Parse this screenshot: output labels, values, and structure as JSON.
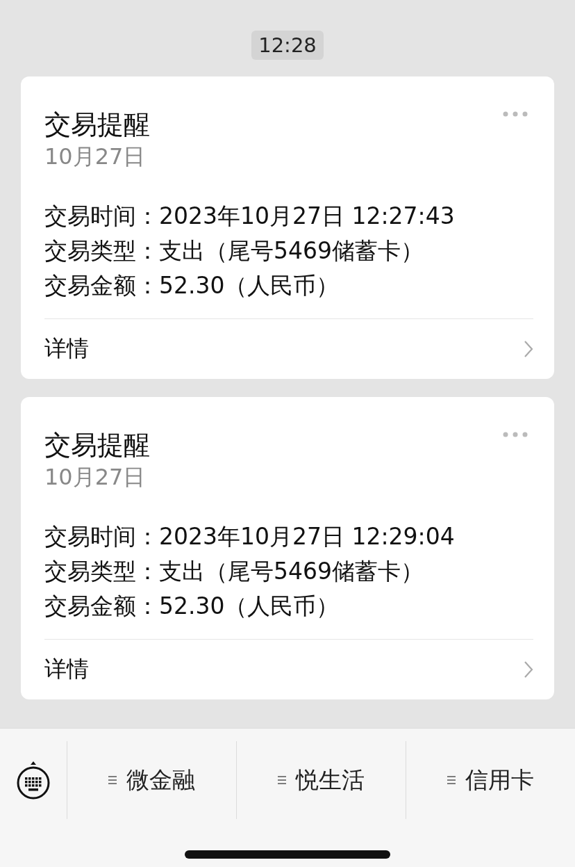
{
  "time": "12:28",
  "messages": [
    {
      "title": "交易提醒",
      "date": "10月27日",
      "fields": [
        {
          "label": "交易时间：",
          "value": "2023年10月27日 12:27:43"
        },
        {
          "label": "交易类型：",
          "value": "支出（尾号5469储蓄卡）"
        },
        {
          "label": "交易金额：",
          "value": "52.30（人民币）"
        }
      ],
      "link": "详情"
    },
    {
      "title": "交易提醒",
      "date": "10月27日",
      "fields": [
        {
          "label": "交易时间：",
          "value": "2023年10月27日 12:29:04"
        },
        {
          "label": "交易类型：",
          "value": "支出（尾号5469储蓄卡）"
        },
        {
          "label": "交易金额：",
          "value": "52.30（人民币）"
        }
      ],
      "link": "详情"
    }
  ],
  "menu": [
    {
      "label": "微金融"
    },
    {
      "label": "悦生活"
    },
    {
      "label": "信用卡"
    }
  ]
}
